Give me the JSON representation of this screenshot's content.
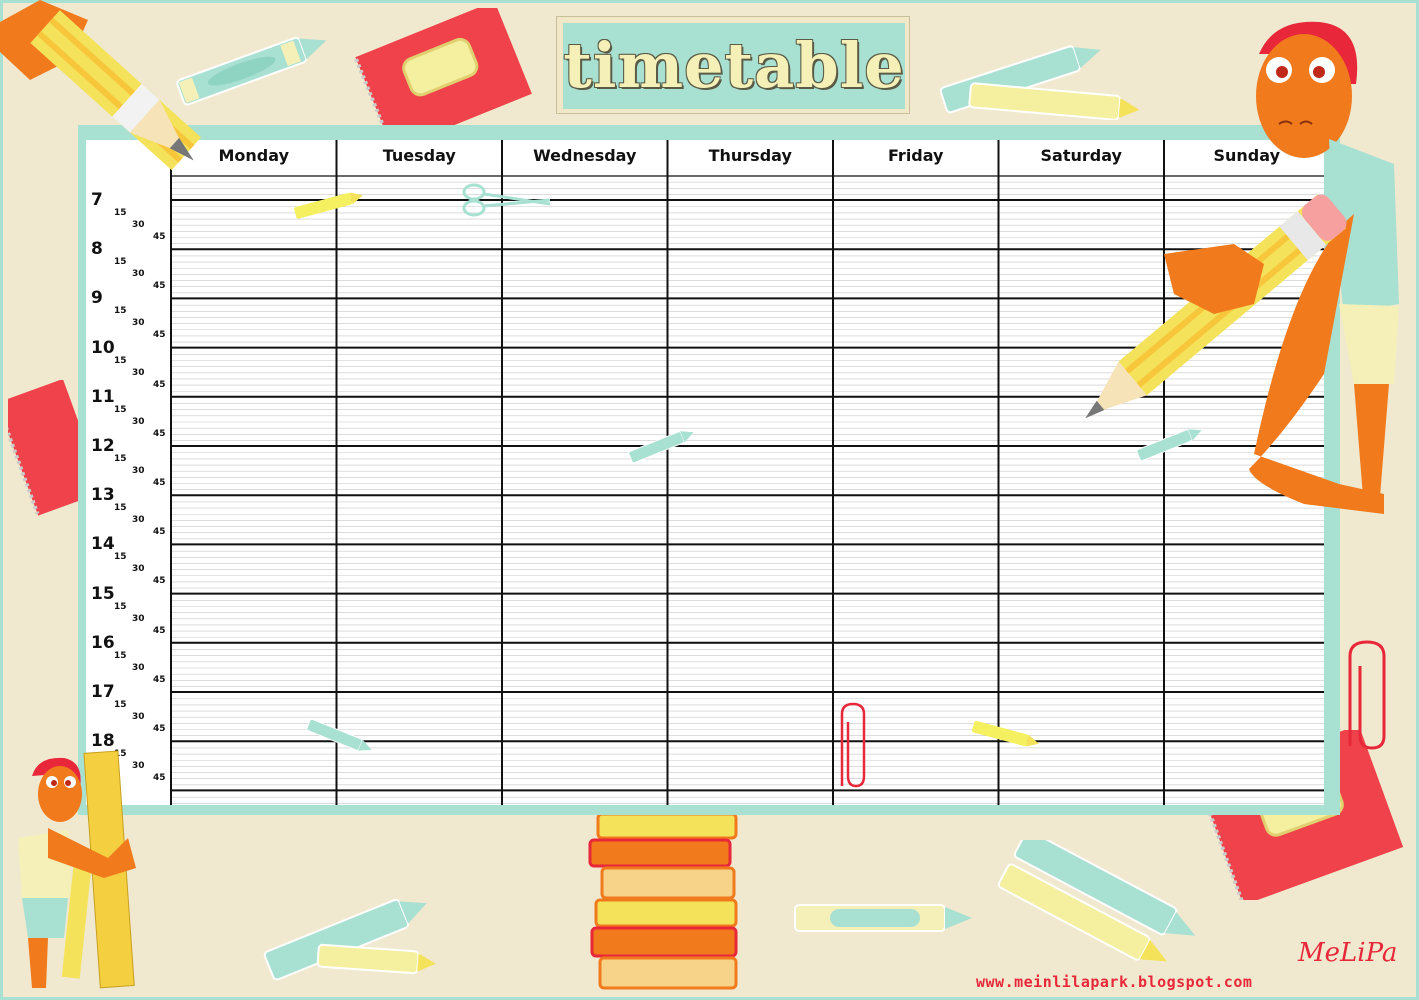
{
  "title": "timetable",
  "days": [
    "Monday",
    "Tuesday",
    "Wednesday",
    "Thursday",
    "Friday",
    "Saturday",
    "Sunday"
  ],
  "hours": [
    "7",
    "8",
    "9",
    "10",
    "11",
    "12",
    "13",
    "14",
    "15",
    "16",
    "17",
    "18"
  ],
  "quarters": [
    "15",
    "30",
    "45"
  ],
  "footer": {
    "url": "www.meinlilapark.blogspot.com",
    "signature": "MeLiPa"
  },
  "colors": {
    "mint": "#a8e0d2",
    "cream": "#f1e9cf",
    "red": "#e8283a",
    "yellow": "#f4e25a",
    "orange": "#f07a1c"
  },
  "decorations": [
    "pencil-icon",
    "crayon-icon",
    "notebook-icon",
    "scissors-icon",
    "paperclip-icon",
    "apple-icon",
    "books-icon",
    "ruler-icon",
    "character-icon"
  ]
}
